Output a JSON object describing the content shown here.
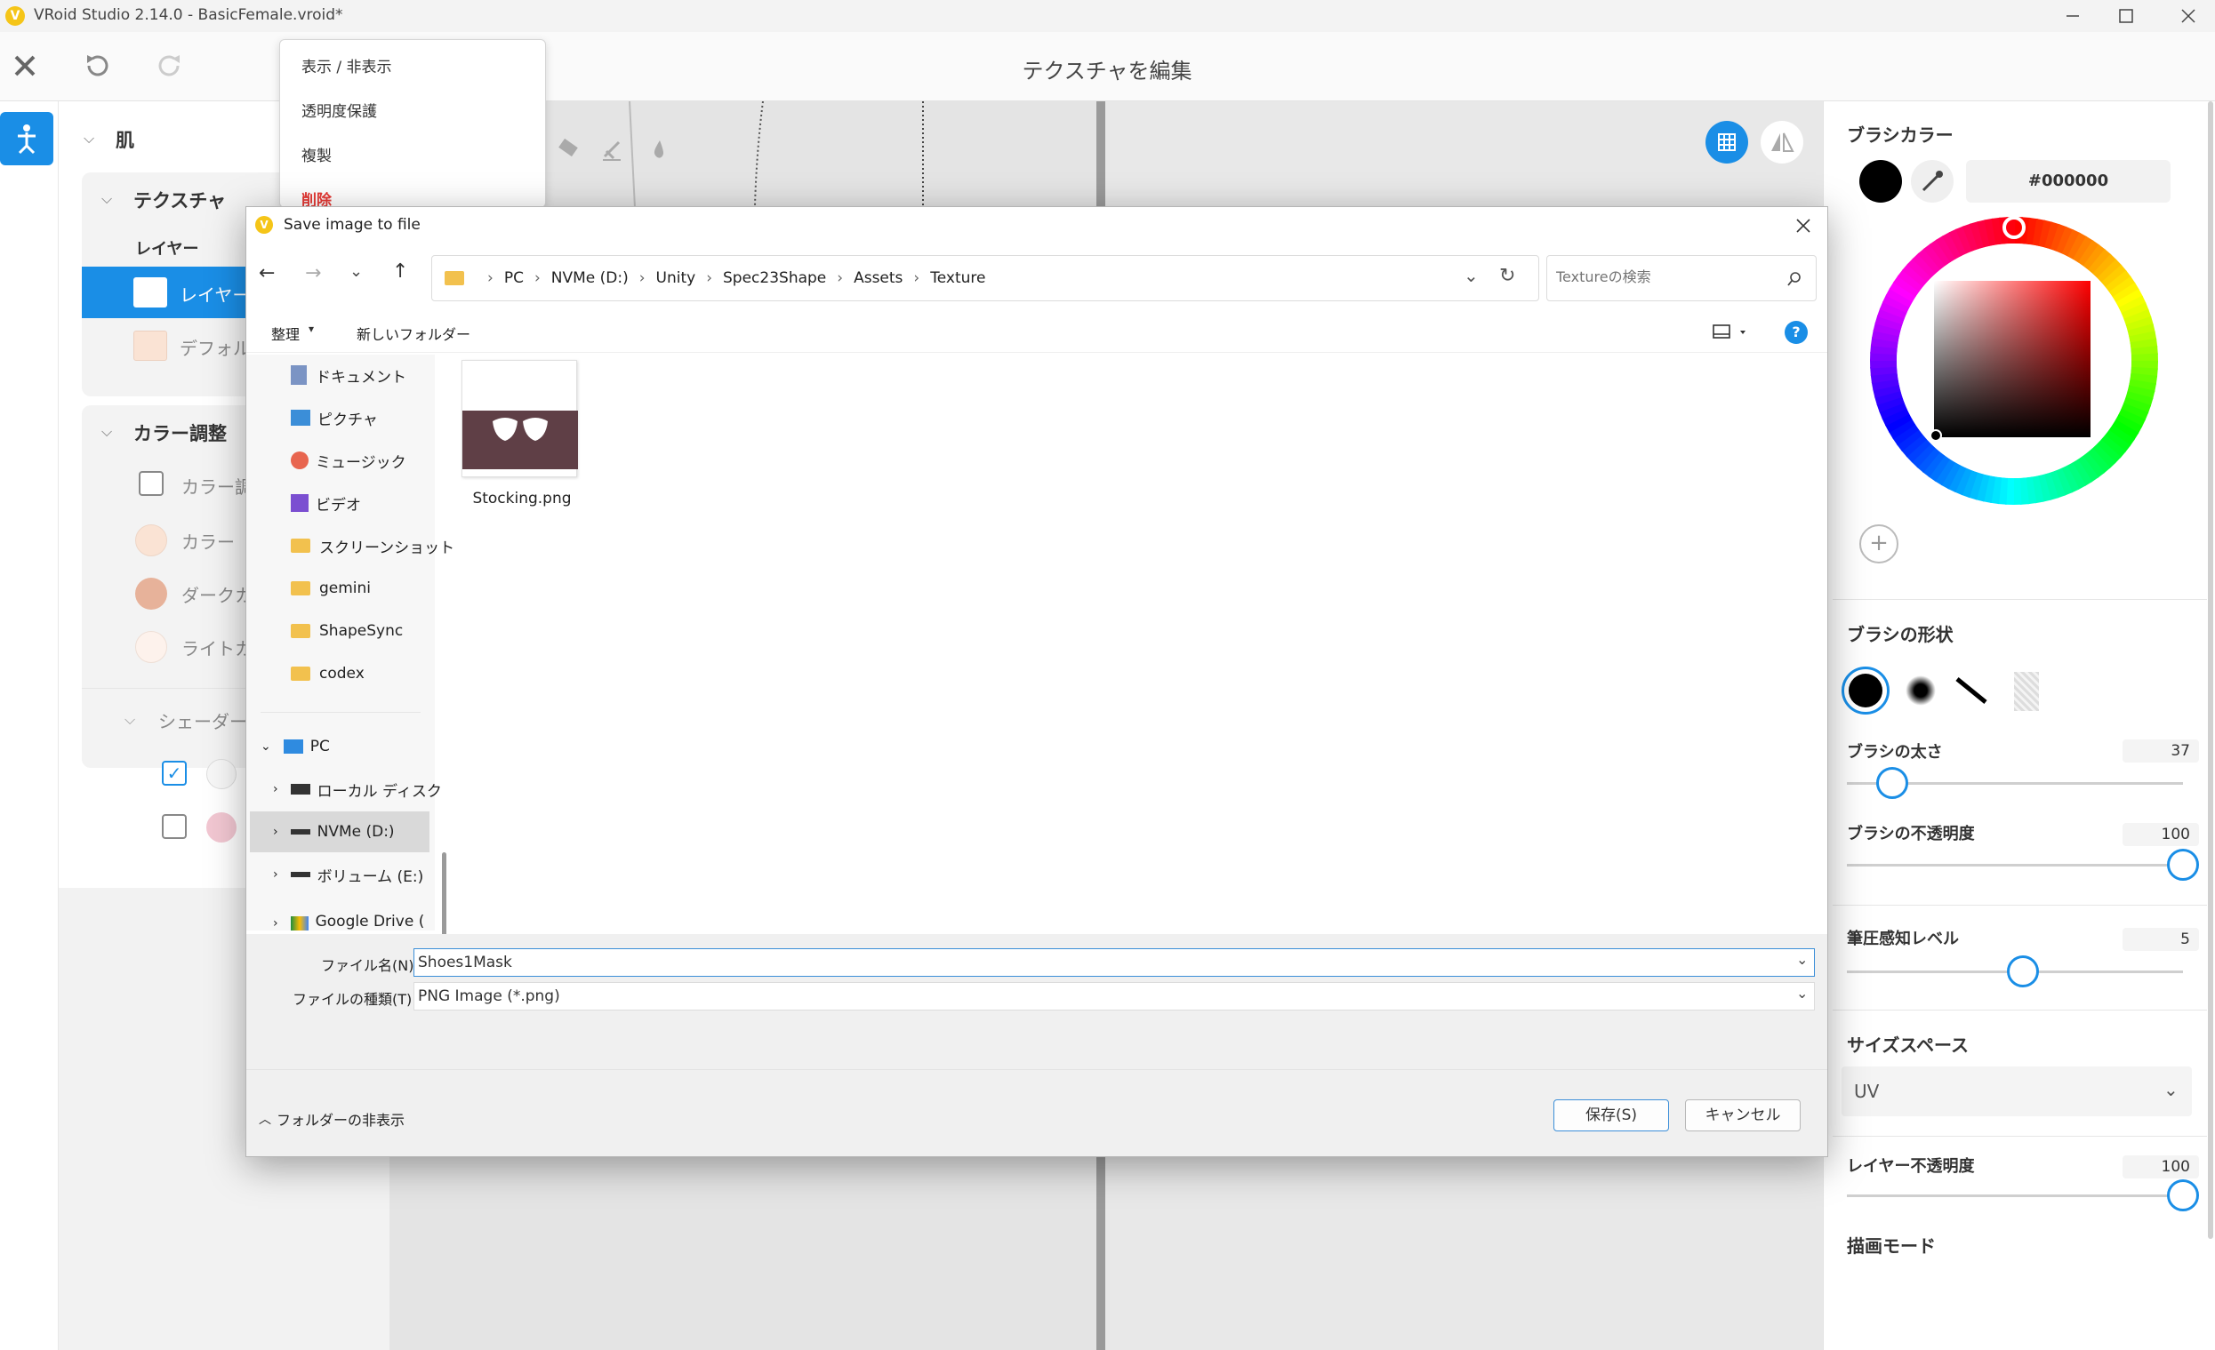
{
  "window": {
    "title": "VRoid Studio 2.14.0 - BasicFemale.vroid*"
  },
  "app": {
    "page_title": "テクスチャを編集"
  },
  "context_menu": {
    "items": [
      "表示 / 非表示",
      "透明度保護",
      "複製",
      "削除"
    ]
  },
  "left_panel": {
    "section_skin": "肌",
    "section_texture": "テクスチャ",
    "layer_heading": "レイヤー",
    "layer_selected": "レイヤー",
    "layer_default": "デフォル",
    "section_color": "カラー調整",
    "color_items": [
      "カラー調",
      "カラー",
      "ダークカ",
      "ライトカ"
    ],
    "section_shader": "シェーダー"
  },
  "right_panel": {
    "brush_color_label": "ブラシカラー",
    "brush_color_hex": "#000000",
    "brush_shape_label": "ブラシの形状",
    "brush_size_label": "ブラシの太さ",
    "brush_size_value": "37",
    "brush_size": 37,
    "brush_opacity_label": "ブラシの不透明度",
    "brush_opacity_value": "100",
    "brush_opacity": 100,
    "pressure_label": "筆圧感知レベル",
    "pressure_value": "5",
    "pressure": 5,
    "size_space_label": "サイズスペース",
    "size_space_value": "UV",
    "layer_opacity_label": "レイヤー不透明度",
    "layer_opacity_value": "100",
    "layer_opacity": 100,
    "draw_mode_label": "描画モード"
  },
  "dialog": {
    "title": "Save image to file",
    "breadcrumb": [
      "PC",
      "NVMe (D:)",
      "Unity",
      "Spec23Shape",
      "Assets",
      "Texture"
    ],
    "search_placeholder": "Textureの検索",
    "organize": "整理",
    "new_folder": "新しいフォルダー",
    "nav_quick": [
      "ドキュメント",
      "ピクチャ",
      "ミュージック",
      "ビデオ",
      "スクリーンショット",
      "gemini",
      "ShapeSync",
      "codex"
    ],
    "nav_pc": "PC",
    "nav_drives": [
      "ローカル ディスク",
      "NVMe (D:)",
      "ボリューム (E:)",
      "Google Drive ("
    ],
    "files": [
      {
        "name": "Stocking.png"
      }
    ],
    "filename_label": "ファイル名(N):",
    "filename_value": "Shoes1Mask",
    "filetype_label": "ファイルの種類(T):",
    "filetype_value": "PNG Image (*.png)",
    "hide_folders": "フォルダーの非表示",
    "save_button": "保存(S)",
    "cancel_button": "キャンセル"
  },
  "colors": {
    "accent": "#1a8ee6",
    "danger": "#e53935",
    "app_logo": "#f5c518"
  }
}
